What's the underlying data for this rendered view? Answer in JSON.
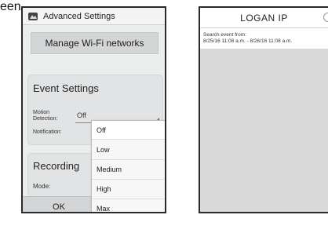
{
  "caption_fragment": "een",
  "left_screen": {
    "header_title": "Advanced Settings",
    "manage_button": "Manage Wi-Fi networks",
    "event_settings": {
      "title": "Event Settings",
      "motion_label_line1": "Motion",
      "motion_label_line2": "Detection:",
      "motion_value": "Off",
      "notification_label": "Notification:"
    },
    "recording": {
      "title": "Recording",
      "mode_label": "Mode:"
    },
    "ok_button": "OK",
    "dropdown_options": [
      "Off",
      "Low",
      "Medium",
      "High",
      "Max"
    ]
  },
  "right_screen": {
    "header_title": "LOGAN IP",
    "search_label": "Search event from:",
    "search_range": "8/25/16 11:08 a.m. - 8/26/16 11:08 a.m."
  }
}
